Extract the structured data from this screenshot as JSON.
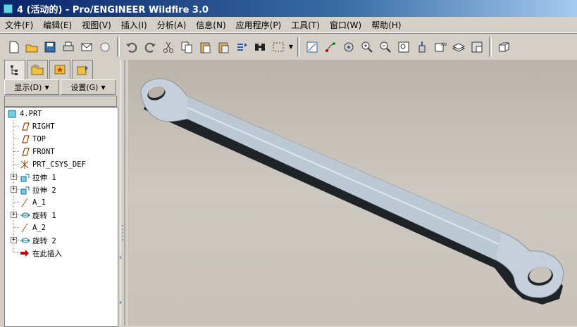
{
  "window": {
    "title": "4 (活动的) - Pro/ENGINEER Wildfire 3.0"
  },
  "menu": [
    {
      "label": "文件(F)",
      "key": "file"
    },
    {
      "label": "编辑(E)",
      "key": "edit"
    },
    {
      "label": "视图(V)",
      "key": "view"
    },
    {
      "label": "插入(I)",
      "key": "insert"
    },
    {
      "label": "分析(A)",
      "key": "analysis"
    },
    {
      "label": "信息(N)",
      "key": "info"
    },
    {
      "label": "应用程序(P)",
      "key": "applications"
    },
    {
      "label": "工具(T)",
      "key": "tools"
    },
    {
      "label": "窗口(W)",
      "key": "window"
    },
    {
      "label": "帮助(H)",
      "key": "help"
    }
  ],
  "toolbar": [
    "new-file-icon",
    "open-file-icon",
    "save-icon",
    "print-icon",
    "send-mail-icon",
    "erase-icon",
    "sep",
    "undo-icon",
    "redo-icon",
    "cut-icon",
    "copy-icon",
    "paste-icon",
    "paste-special-icon",
    "regenerate-icon",
    "find-icon",
    "selection-box-icon",
    "dropdown",
    "sep",
    "datum-display-icon",
    "axis-display-icon",
    "spin-center-icon",
    "zoom-in-icon",
    "zoom-out-icon",
    "refit-icon",
    "reorient-icon",
    "view-manager-icon",
    "layers-icon",
    "saved-views-icon",
    "sep",
    "shading-icon"
  ],
  "panel": {
    "tabs": [
      "model-tree-icon",
      "folder-browser-icon",
      "favorites-icon",
      "connections-icon"
    ],
    "show_label": "显示(D)",
    "settings_label": "设置(G)"
  },
  "tree": [
    {
      "label": "4.PRT",
      "icon": "part-icon",
      "level": 0,
      "expander": false
    },
    {
      "label": "RIGHT",
      "icon": "datum-plane-icon",
      "level": 1,
      "expander": false
    },
    {
      "label": "TOP",
      "icon": "datum-plane-icon",
      "level": 1,
      "expander": false
    },
    {
      "label": "FRONT",
      "icon": "datum-plane-icon",
      "level": 1,
      "expander": false
    },
    {
      "label": "PRT_CSYS_DEF",
      "icon": "csys-icon",
      "level": 1,
      "expander": false
    },
    {
      "label": "拉伸 1",
      "icon": "extrude-icon",
      "level": 1,
      "expander": true
    },
    {
      "label": "拉伸 2",
      "icon": "extrude-icon",
      "level": 1,
      "expander": true
    },
    {
      "label": "A_1",
      "icon": "datum-axis-icon",
      "level": 1,
      "expander": false
    },
    {
      "label": "旋转 1",
      "icon": "revolve-icon",
      "level": 1,
      "expander": true
    },
    {
      "label": "A_2",
      "icon": "datum-axis-icon",
      "level": 1,
      "expander": false
    },
    {
      "label": "旋转 2",
      "icon": "revolve-icon",
      "level": 1,
      "expander": true
    },
    {
      "label": "在此插入",
      "icon": "insert-here-arrow-icon",
      "level": 1,
      "expander": false
    }
  ],
  "colors": {
    "title_start": "#0a246a",
    "title_end": "#a6caf0",
    "model_face": "#c5d0dc",
    "model_side": "#1e2328",
    "insert_arrow": "#c00000"
  }
}
